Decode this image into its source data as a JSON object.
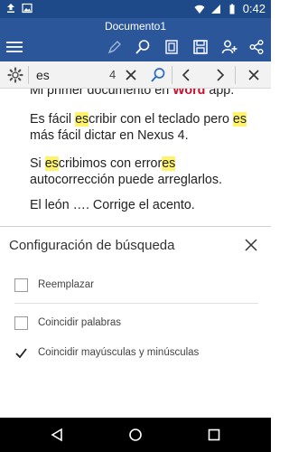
{
  "status_bar": {
    "time": "0:42",
    "icons": [
      "upload-icon",
      "image-icon",
      "wifi-icon",
      "signal-icon",
      "battery-icon"
    ]
  },
  "title_bar": {
    "title": "Documento1",
    "icons": [
      "menu-icon",
      "pen-icon",
      "search-icon",
      "reading-view-icon",
      "save-icon",
      "add-person-icon",
      "share-icon"
    ]
  },
  "find_bar": {
    "query": "es",
    "count": "4",
    "icons": [
      "settings-gear-icon",
      "clear-icon",
      "search-icon",
      "previous-icon",
      "next-icon",
      "close-icon"
    ]
  },
  "document": {
    "line1": {
      "before": "Mi primer documento en ",
      "word": "Word",
      "after": " app."
    },
    "para2": [
      {
        "t": "Es fácil ",
        "hl": false
      },
      {
        "t": "es",
        "hl": true
      },
      {
        "t": "cribir con el teclado pero ",
        "hl": false
      },
      {
        "t": "es",
        "hl": true
      },
      {
        "t": " más fácil dictar en Nexus 4.",
        "hl": false
      }
    ],
    "para3": [
      {
        "t": "Si ",
        "hl": false
      },
      {
        "t": "es",
        "hl": true
      },
      {
        "t": "cribimos con error",
        "hl": false
      },
      {
        "t": "es",
        "hl": true
      },
      {
        "t": " autocorrección puede arreglarlos.",
        "hl": false
      }
    ],
    "para4": "El león …. Corrige el acento."
  },
  "search_settings": {
    "title": "Configuración de búsqueda",
    "options": [
      {
        "label": "Reemplazar",
        "checked": false
      },
      {
        "label": "Coincidir palabras",
        "checked": false
      },
      {
        "label": "Coincidir mayúsculas y minúsculas",
        "checked": true
      }
    ]
  },
  "nav_bar": {
    "icons": [
      "back-icon",
      "home-icon",
      "recents-icon"
    ]
  },
  "colors": {
    "title_bar": "#2b579a",
    "status_bar": "#1e4a8a",
    "highlight": "#fff36b",
    "word_red": "#c8102e"
  }
}
